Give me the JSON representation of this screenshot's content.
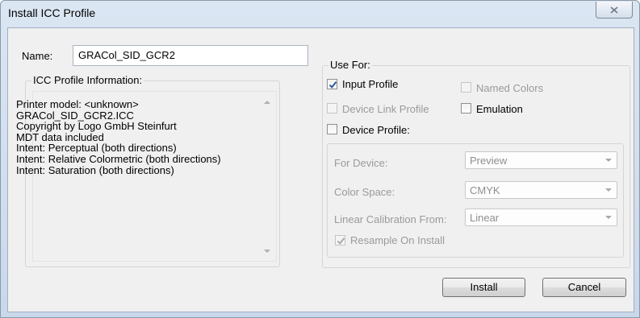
{
  "window": {
    "title": "Install ICC Profile"
  },
  "name_field": {
    "label": "Name:",
    "value": "GRACol_SID_GCR2"
  },
  "profile_info": {
    "legend": "ICC Profile Information:",
    "lines": [
      "Printer model: <unknown>",
      "GRACol_SID_GCR2.ICC",
      "Copyright by Logo GmbH Steinfurt",
      "MDT data included",
      "Intent: Perceptual (both directions)",
      "Intent: Relative Colormetric (both directions)",
      "Intent: Saturation (both directions)"
    ]
  },
  "use_for": {
    "legend": "Use For:",
    "input_profile": {
      "label": "Input Profile",
      "checked": true,
      "enabled": true
    },
    "named_colors": {
      "label": "Named Colors",
      "checked": false,
      "enabled": false
    },
    "device_link_profile": {
      "label": "Device Link Profile",
      "checked": false,
      "enabled": false
    },
    "emulation": {
      "label": "Emulation",
      "checked": false,
      "enabled": true
    },
    "device_profile": {
      "label": "Device Profile:",
      "checked": false,
      "enabled": true
    }
  },
  "device_settings": {
    "for_device": {
      "label": "For Device:",
      "value": "Preview"
    },
    "color_space": {
      "label": "Color Space:",
      "value": "CMYK"
    },
    "linear_calibration": {
      "label": "Linear Calibration From:",
      "value": "Linear"
    },
    "resample": {
      "label": "Resample On Install",
      "checked": true,
      "enabled": false
    }
  },
  "buttons": {
    "install": "Install",
    "cancel": "Cancel"
  },
  "colors": {
    "accent_check": "#2c5a9c",
    "disabled_text": "#9a9a9a"
  }
}
